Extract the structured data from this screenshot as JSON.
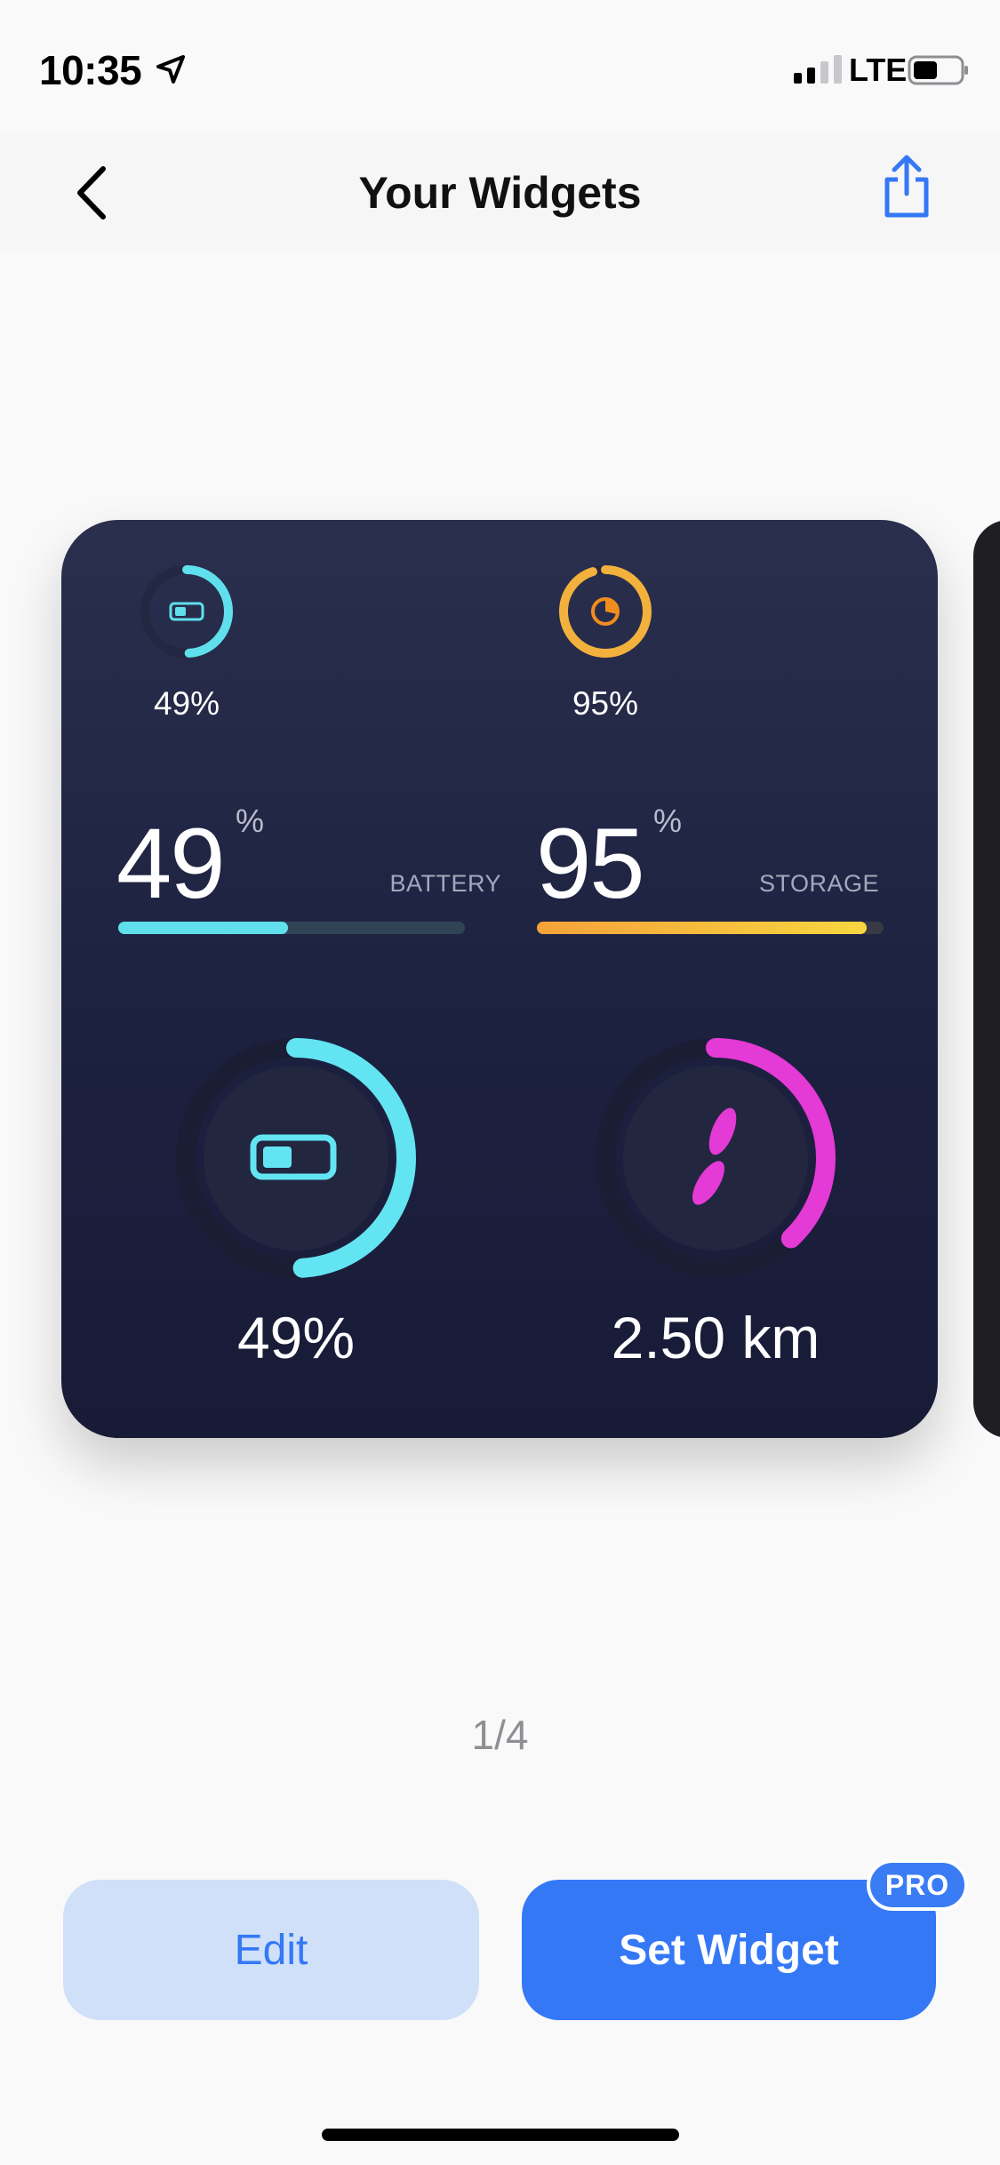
{
  "status_bar": {
    "time": "10:35",
    "network": "LTE"
  },
  "nav": {
    "title": "Your Widgets"
  },
  "widget": {
    "small_battery": {
      "value": "49%",
      "fraction": 0.49,
      "color": "#5fe0ec"
    },
    "small_storage": {
      "value": "95%",
      "fraction": 0.95,
      "color": "#f2b13c"
    },
    "battery_metric": {
      "number": "49",
      "unit": "%",
      "label": "BATTERY",
      "fraction": 0.49,
      "color": "#5fe0ec"
    },
    "storage_metric": {
      "number": "95",
      "unit": "%",
      "label": "STORAGE",
      "fraction": 0.95,
      "color": "#f7a63a"
    },
    "battery_ring": {
      "value": "49%",
      "fraction": 0.49,
      "color": "#63e4f2"
    },
    "steps_ring": {
      "value": "2.50 km",
      "fraction": 0.38,
      "color": "#e43ad6"
    }
  },
  "pager": {
    "indicator": "1/4"
  },
  "actions": {
    "edit_label": "Edit",
    "set_label": "Set Widget",
    "badge": "PRO"
  },
  "colors": {
    "accent": "#3478f6",
    "card_bg": "#1f2342"
  }
}
